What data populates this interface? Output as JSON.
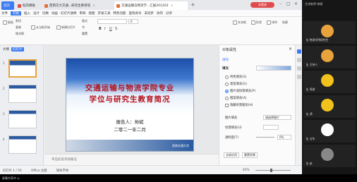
{
  "tabs": [
    {
      "label": "首页",
      "color": "#3d7cf0"
    },
    {
      "label": "稻壳模板",
      "color": "#e04c4c"
    },
    {
      "label": "西南交大交通...研究生教育现",
      "color": "#e2703a"
    },
    {
      "label": "交通运输与物流学...汇报201203",
      "color": "#e2703a"
    }
  ],
  "login_label": "未登录",
  "menu": [
    "文件",
    "开始",
    "插入",
    "设计",
    "切换",
    "动画",
    "幻灯片放映",
    "审阅",
    "视图",
    "开发工具",
    "特色功能",
    "查找命令",
    "未同步",
    "协作",
    "分享"
  ],
  "ribbon": {
    "paste": "粘贴",
    "cut": "剪切",
    "copy": "复制",
    "format_painter": "格式刷",
    "from_current": "从当前开始",
    "new_slide": "新建幻灯片",
    "layout": "版式",
    "section": "节",
    "reset": "重置",
    "font_size": "0",
    "text_box": "文本框",
    "shape": "形状",
    "arrange": "排列",
    "outline": "轮廓"
  },
  "left_panel": {
    "tab_outline": "大纲",
    "tab_slides": "幻灯片",
    "slide_numbers": [
      "1",
      "2",
      "3",
      "4"
    ]
  },
  "slide": {
    "title_line1": "交通运输与物流学院专业",
    "title_line2": "学位与研究生教育简况",
    "reporter": "报告人：帅斌",
    "date": "二零二一年二月",
    "logo_text": "西南交通大学"
  },
  "notes_placeholder": "单击此处添加备注",
  "right_panel": {
    "title": "对象属性",
    "subtab": "填充",
    "fill_header": "填充",
    "options": [
      {
        "label": "纯色填充(S)",
        "selected": false
      },
      {
        "label": "渐变填充(G)",
        "selected": false
      },
      {
        "label": "图片或纹理填充(P)",
        "selected": true
      },
      {
        "label": "图案填充(A)",
        "selected": false
      },
      {
        "label": "隐藏背景图形(H)",
        "selected": false
      }
    ],
    "picture_fill_label": "图片填充",
    "picture_fill_value": "请选择图片",
    "tile_label": "纹理填充(U)",
    "transparency_label": "透明度(T)",
    "transparency_value": "0%",
    "apply_all": "全部应用",
    "reset_bg": "重置背景"
  },
  "status": {
    "slide_count": "幻灯片 1 / 50",
    "theme": "Office 主题",
    "missing_font": "缺失字体",
    "zoom": "45%",
    "zoom_fraction": 0.45
  },
  "video_panel": {
    "header": "主讲老师 帅斌",
    "participants": [
      {
        "name": "物流学院研究生",
        "color": "#e8a33c"
      },
      {
        "name": "主持人",
        "color": "#e8a33c"
      },
      {
        "name": "周游",
        "color": "#f2c21c"
      },
      {
        "name": "谭",
        "color": "#f2c21c"
      },
      {
        "name": "五年",
        "color": "#ffffff"
      },
      {
        "name": "宋彦",
        "color": "#ffffff"
      },
      {
        "name": "赵",
        "color": "#888888"
      }
    ]
  },
  "bottom_strip": "屏幕共享中  ◎"
}
